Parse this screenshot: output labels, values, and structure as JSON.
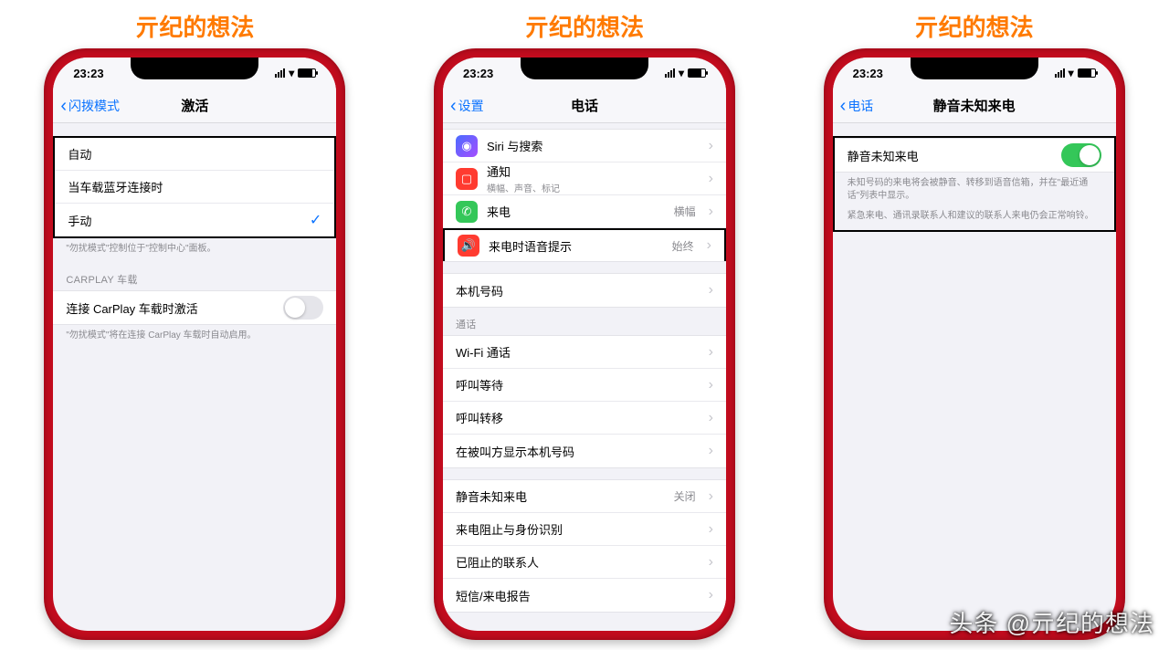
{
  "top_label": "亓纪的想法",
  "watermark": "头条 @亓纪的想法",
  "status": {
    "time": "23:23"
  },
  "phone1": {
    "back": "闪拨模式",
    "title": "激活",
    "rows": [
      "自动",
      "当车载蓝牙连接时",
      "手动"
    ],
    "footer1": "\"勿扰模式\"控制位于\"控制中心\"面板。",
    "section2_header": "CARPLAY 车载",
    "carplay_label": "连接 CarPlay 车载时激活",
    "footer2": "\"勿扰模式\"将在连接 CarPlay 车载时自动启用。"
  },
  "phone2": {
    "back": "设置",
    "title": "电话",
    "row_siri": "Siri 与搜索",
    "row_notif": "通知",
    "row_notif_sub": "横幅、声音、标记",
    "row_incoming": "来电",
    "row_incoming_val": "横幅",
    "row_announce": "来电时语音提示",
    "row_announce_val": "始终",
    "row_mynum": "本机号码",
    "section_calls": "通话",
    "row_wifi": "Wi-Fi 通话",
    "row_respond": "呼叫等待",
    "row_forward": "呼叫转移",
    "row_showid": "在被叫方显示本机号码",
    "row_silence": "静音未知来电",
    "row_silence_val": "关闭",
    "row_blocked": "来电阻止与身份识别",
    "row_blocked2": "已阻止的联系人",
    "row_sms": "短信/来电报告"
  },
  "phone3": {
    "back": "电话",
    "title": "静音未知来电",
    "toggle_label": "静音未知来电",
    "footer_a": "未知号码的来电将会被静音、转移到语音信箱，并在\"最近通话\"列表中显示。",
    "footer_b": "紧急来电、通讯录联系人和建议的联系人来电仍会正常响铃。"
  }
}
